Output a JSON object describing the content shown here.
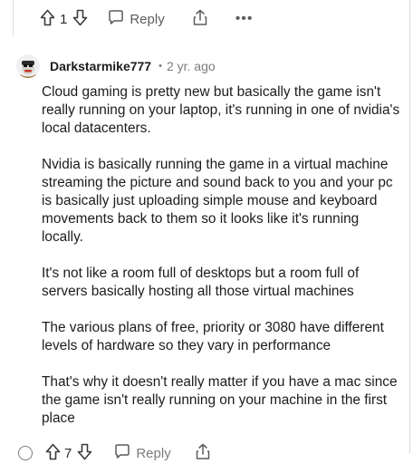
{
  "actions": {
    "upvote_icon": "arrow-up-icon",
    "vote_count": "1",
    "downvote_icon": "arrow-down-icon",
    "reply_label": "Reply",
    "share_icon": "share-icon",
    "more_label": "•••"
  },
  "comment": {
    "username": "Darkstarmike777",
    "separator": "•",
    "timestamp": "2 yr. ago",
    "paragraphs": [
      "Cloud gaming is pretty new but basically the game isn't really running on your laptop, it's running in one of nvidia's local datacenters.",
      "Nvidia is basically running the game in a virtual machine streaming the picture and sound back to you and your pc is basically just uploading simple mouse and keyboard movements back to them so it looks like it's running locally.",
      "It's not like a room full of desktops but a room full of servers basically hosting all those virtual machines",
      "The various plans of free, priority or 3080 have different levels of hardware so they vary in performance",
      "That's why it doesn't really matter if you have a mac since the game isn't really running on your machine in the first place"
    ]
  },
  "next_actions": {
    "vote_count": "7",
    "reply_label": "Reply"
  },
  "colors": {
    "text": "#1c1c1c",
    "muted": "#7c7c7c",
    "icon": "#5c5c5c"
  }
}
